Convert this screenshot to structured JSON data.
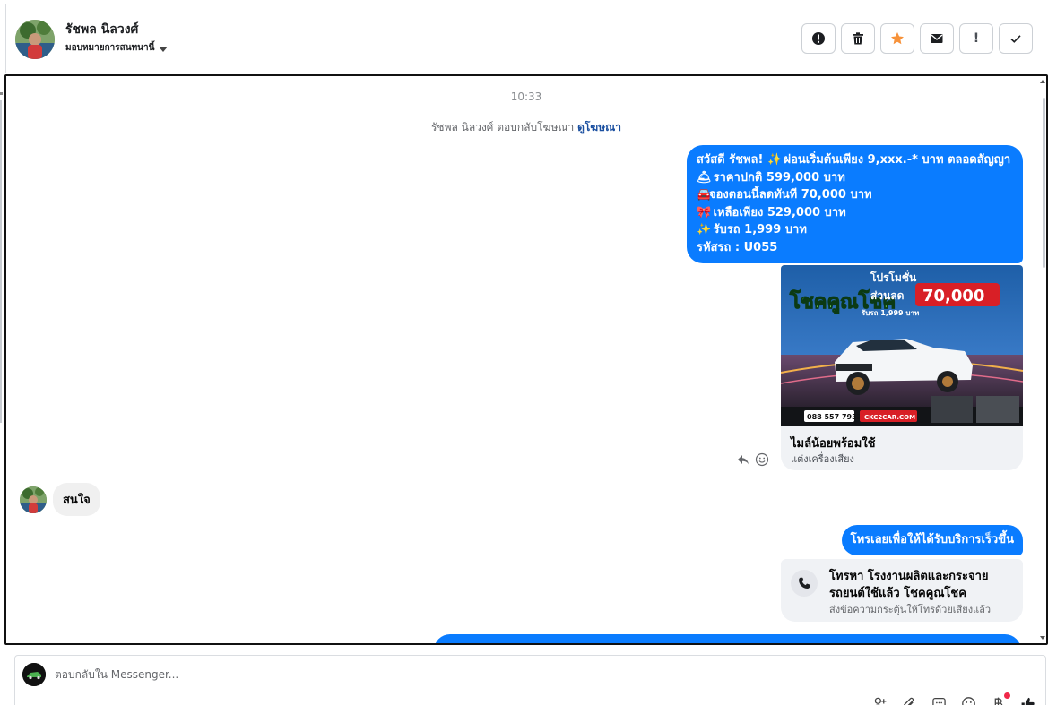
{
  "header": {
    "contact_name": "รัชพล นิลวงศ์",
    "assign_label": "มอบหมายการสนทนานี้",
    "actions": [
      {
        "name": "spam-icon",
        "glyph": ""
      },
      {
        "name": "trash-icon",
        "glyph": ""
      },
      {
        "name": "star-icon",
        "glyph": ""
      },
      {
        "name": "mail-icon",
        "glyph": ""
      },
      {
        "name": "important-icon",
        "glyph": "!"
      },
      {
        "name": "check-icon",
        "glyph": ""
      }
    ],
    "star_color": "#f7923a"
  },
  "conversation": {
    "timestamp": "10:33",
    "ad_reply_text": "รัชพล นิลวงศ์ ตอบกลับโฆษณา",
    "ad_reply_link": "ดูโฆษณา",
    "message_1": {
      "line_1_a": "สวัสดี รัชพล!",
      "line_1_b": "ผ่อนเริ่มต้นเพียง 9,xxx.-* บาท ตลอดสัญญา",
      "line_2": "ราคาปกติ 599,000 บาท",
      "line_3": "จองตอนนี้ลดทันที  70,000 บาท",
      "line_4": "เหลือเพียง 529,000 บาท",
      "line_5": "รับรถ 1,999 บาท",
      "line_6": "รหัสรถ : U055"
    },
    "ad_card": {
      "title": "ไมล์น้อยพร้อมใช้",
      "subtitle": "แต่งเครื่องเสียง",
      "image": {
        "headline": "โชคคูณโชค",
        "promo_label": "โปรโมชั่น",
        "discount_label": "ส่วนลด",
        "discount_value": "70,000",
        "pickup": "รับรถ 1,999 บาท",
        "phone": "088 557 7932",
        "website": "CKC2CAR.COM"
      }
    },
    "incoming_message": "สนใจ",
    "message_2": "โทรเลยเพื่อให้ได้รับบริการเร็วขึ้น",
    "call_card": {
      "title": "โทรหา โรงงานผลิตและกระจายรถยนต์ใช้แล้ว โชคคูณโชค",
      "subtitle": "ส่งข้อความกระตุ้นให้โทรด้วยเสียงแล้ว"
    },
    "bubble_color": "#0a7cff"
  },
  "composer": {
    "placeholder": "ตอบกลับใน Messenger..."
  }
}
